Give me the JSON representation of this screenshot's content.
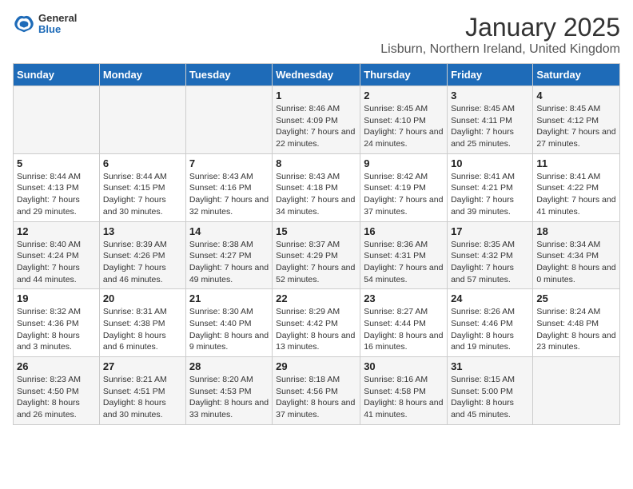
{
  "logo": {
    "general": "General",
    "blue": "Blue"
  },
  "header": {
    "title": "January 2025",
    "subtitle": "Lisburn, Northern Ireland, United Kingdom"
  },
  "weekdays": [
    "Sunday",
    "Monday",
    "Tuesday",
    "Wednesday",
    "Thursday",
    "Friday",
    "Saturday"
  ],
  "weeks": [
    [
      {
        "day": "",
        "sunrise": "",
        "sunset": "",
        "daylight": ""
      },
      {
        "day": "",
        "sunrise": "",
        "sunset": "",
        "daylight": ""
      },
      {
        "day": "",
        "sunrise": "",
        "sunset": "",
        "daylight": ""
      },
      {
        "day": "1",
        "sunrise": "Sunrise: 8:46 AM",
        "sunset": "Sunset: 4:09 PM",
        "daylight": "Daylight: 7 hours and 22 minutes."
      },
      {
        "day": "2",
        "sunrise": "Sunrise: 8:45 AM",
        "sunset": "Sunset: 4:10 PM",
        "daylight": "Daylight: 7 hours and 24 minutes."
      },
      {
        "day": "3",
        "sunrise": "Sunrise: 8:45 AM",
        "sunset": "Sunset: 4:11 PM",
        "daylight": "Daylight: 7 hours and 25 minutes."
      },
      {
        "day": "4",
        "sunrise": "Sunrise: 8:45 AM",
        "sunset": "Sunset: 4:12 PM",
        "daylight": "Daylight: 7 hours and 27 minutes."
      }
    ],
    [
      {
        "day": "5",
        "sunrise": "Sunrise: 8:44 AM",
        "sunset": "Sunset: 4:13 PM",
        "daylight": "Daylight: 7 hours and 29 minutes."
      },
      {
        "day": "6",
        "sunrise": "Sunrise: 8:44 AM",
        "sunset": "Sunset: 4:15 PM",
        "daylight": "Daylight: 7 hours and 30 minutes."
      },
      {
        "day": "7",
        "sunrise": "Sunrise: 8:43 AM",
        "sunset": "Sunset: 4:16 PM",
        "daylight": "Daylight: 7 hours and 32 minutes."
      },
      {
        "day": "8",
        "sunrise": "Sunrise: 8:43 AM",
        "sunset": "Sunset: 4:18 PM",
        "daylight": "Daylight: 7 hours and 34 minutes."
      },
      {
        "day": "9",
        "sunrise": "Sunrise: 8:42 AM",
        "sunset": "Sunset: 4:19 PM",
        "daylight": "Daylight: 7 hours and 37 minutes."
      },
      {
        "day": "10",
        "sunrise": "Sunrise: 8:41 AM",
        "sunset": "Sunset: 4:21 PM",
        "daylight": "Daylight: 7 hours and 39 minutes."
      },
      {
        "day": "11",
        "sunrise": "Sunrise: 8:41 AM",
        "sunset": "Sunset: 4:22 PM",
        "daylight": "Daylight: 7 hours and 41 minutes."
      }
    ],
    [
      {
        "day": "12",
        "sunrise": "Sunrise: 8:40 AM",
        "sunset": "Sunset: 4:24 PM",
        "daylight": "Daylight: 7 hours and 44 minutes."
      },
      {
        "day": "13",
        "sunrise": "Sunrise: 8:39 AM",
        "sunset": "Sunset: 4:26 PM",
        "daylight": "Daylight: 7 hours and 46 minutes."
      },
      {
        "day": "14",
        "sunrise": "Sunrise: 8:38 AM",
        "sunset": "Sunset: 4:27 PM",
        "daylight": "Daylight: 7 hours and 49 minutes."
      },
      {
        "day": "15",
        "sunrise": "Sunrise: 8:37 AM",
        "sunset": "Sunset: 4:29 PM",
        "daylight": "Daylight: 7 hours and 52 minutes."
      },
      {
        "day": "16",
        "sunrise": "Sunrise: 8:36 AM",
        "sunset": "Sunset: 4:31 PM",
        "daylight": "Daylight: 7 hours and 54 minutes."
      },
      {
        "day": "17",
        "sunrise": "Sunrise: 8:35 AM",
        "sunset": "Sunset: 4:32 PM",
        "daylight": "Daylight: 7 hours and 57 minutes."
      },
      {
        "day": "18",
        "sunrise": "Sunrise: 8:34 AM",
        "sunset": "Sunset: 4:34 PM",
        "daylight": "Daylight: 8 hours and 0 minutes."
      }
    ],
    [
      {
        "day": "19",
        "sunrise": "Sunrise: 8:32 AM",
        "sunset": "Sunset: 4:36 PM",
        "daylight": "Daylight: 8 hours and 3 minutes."
      },
      {
        "day": "20",
        "sunrise": "Sunrise: 8:31 AM",
        "sunset": "Sunset: 4:38 PM",
        "daylight": "Daylight: 8 hours and 6 minutes."
      },
      {
        "day": "21",
        "sunrise": "Sunrise: 8:30 AM",
        "sunset": "Sunset: 4:40 PM",
        "daylight": "Daylight: 8 hours and 9 minutes."
      },
      {
        "day": "22",
        "sunrise": "Sunrise: 8:29 AM",
        "sunset": "Sunset: 4:42 PM",
        "daylight": "Daylight: 8 hours and 13 minutes."
      },
      {
        "day": "23",
        "sunrise": "Sunrise: 8:27 AM",
        "sunset": "Sunset: 4:44 PM",
        "daylight": "Daylight: 8 hours and 16 minutes."
      },
      {
        "day": "24",
        "sunrise": "Sunrise: 8:26 AM",
        "sunset": "Sunset: 4:46 PM",
        "daylight": "Daylight: 8 hours and 19 minutes."
      },
      {
        "day": "25",
        "sunrise": "Sunrise: 8:24 AM",
        "sunset": "Sunset: 4:48 PM",
        "daylight": "Daylight: 8 hours and 23 minutes."
      }
    ],
    [
      {
        "day": "26",
        "sunrise": "Sunrise: 8:23 AM",
        "sunset": "Sunset: 4:50 PM",
        "daylight": "Daylight: 8 hours and 26 minutes."
      },
      {
        "day": "27",
        "sunrise": "Sunrise: 8:21 AM",
        "sunset": "Sunset: 4:51 PM",
        "daylight": "Daylight: 8 hours and 30 minutes."
      },
      {
        "day": "28",
        "sunrise": "Sunrise: 8:20 AM",
        "sunset": "Sunset: 4:53 PM",
        "daylight": "Daylight: 8 hours and 33 minutes."
      },
      {
        "day": "29",
        "sunrise": "Sunrise: 8:18 AM",
        "sunset": "Sunset: 4:56 PM",
        "daylight": "Daylight: 8 hours and 37 minutes."
      },
      {
        "day": "30",
        "sunrise": "Sunrise: 8:16 AM",
        "sunset": "Sunset: 4:58 PM",
        "daylight": "Daylight: 8 hours and 41 minutes."
      },
      {
        "day": "31",
        "sunrise": "Sunrise: 8:15 AM",
        "sunset": "Sunset: 5:00 PM",
        "daylight": "Daylight: 8 hours and 45 minutes."
      },
      {
        "day": "",
        "sunrise": "",
        "sunset": "",
        "daylight": ""
      }
    ]
  ]
}
